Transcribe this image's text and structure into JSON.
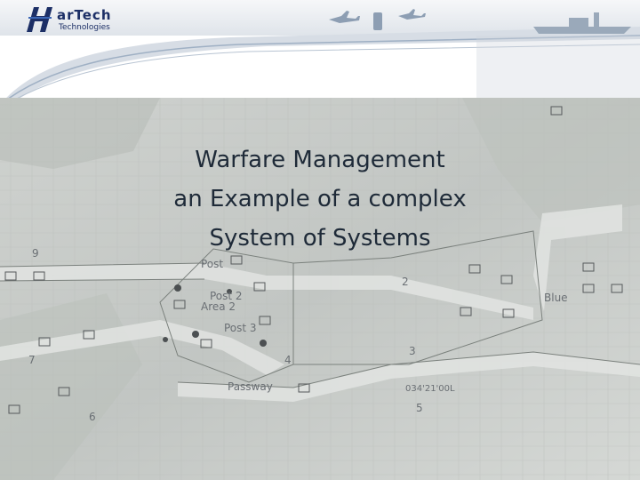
{
  "header": {
    "logo_top": "arTech",
    "logo_bottom": "Technologies"
  },
  "title": {
    "line1": "Warfare Management",
    "line2": "an Example of a complex",
    "line3": "System of Systems"
  },
  "map_labels": {
    "post1": "Post",
    "post2": "Post 2",
    "area2": "Area 2",
    "post3": "Post 3",
    "blue": "Blue",
    "passway": "Passway",
    "coords": "034'21'00L",
    "n9": "9",
    "n2": "2",
    "n7": "7",
    "n4": "4",
    "n3": "3",
    "n6": "6",
    "n5": "5"
  },
  "colors": {
    "logo": "#1c2f66",
    "title": "#1e2a38",
    "map_base": "#c9ccc9",
    "route": "#e2e4e2"
  }
}
